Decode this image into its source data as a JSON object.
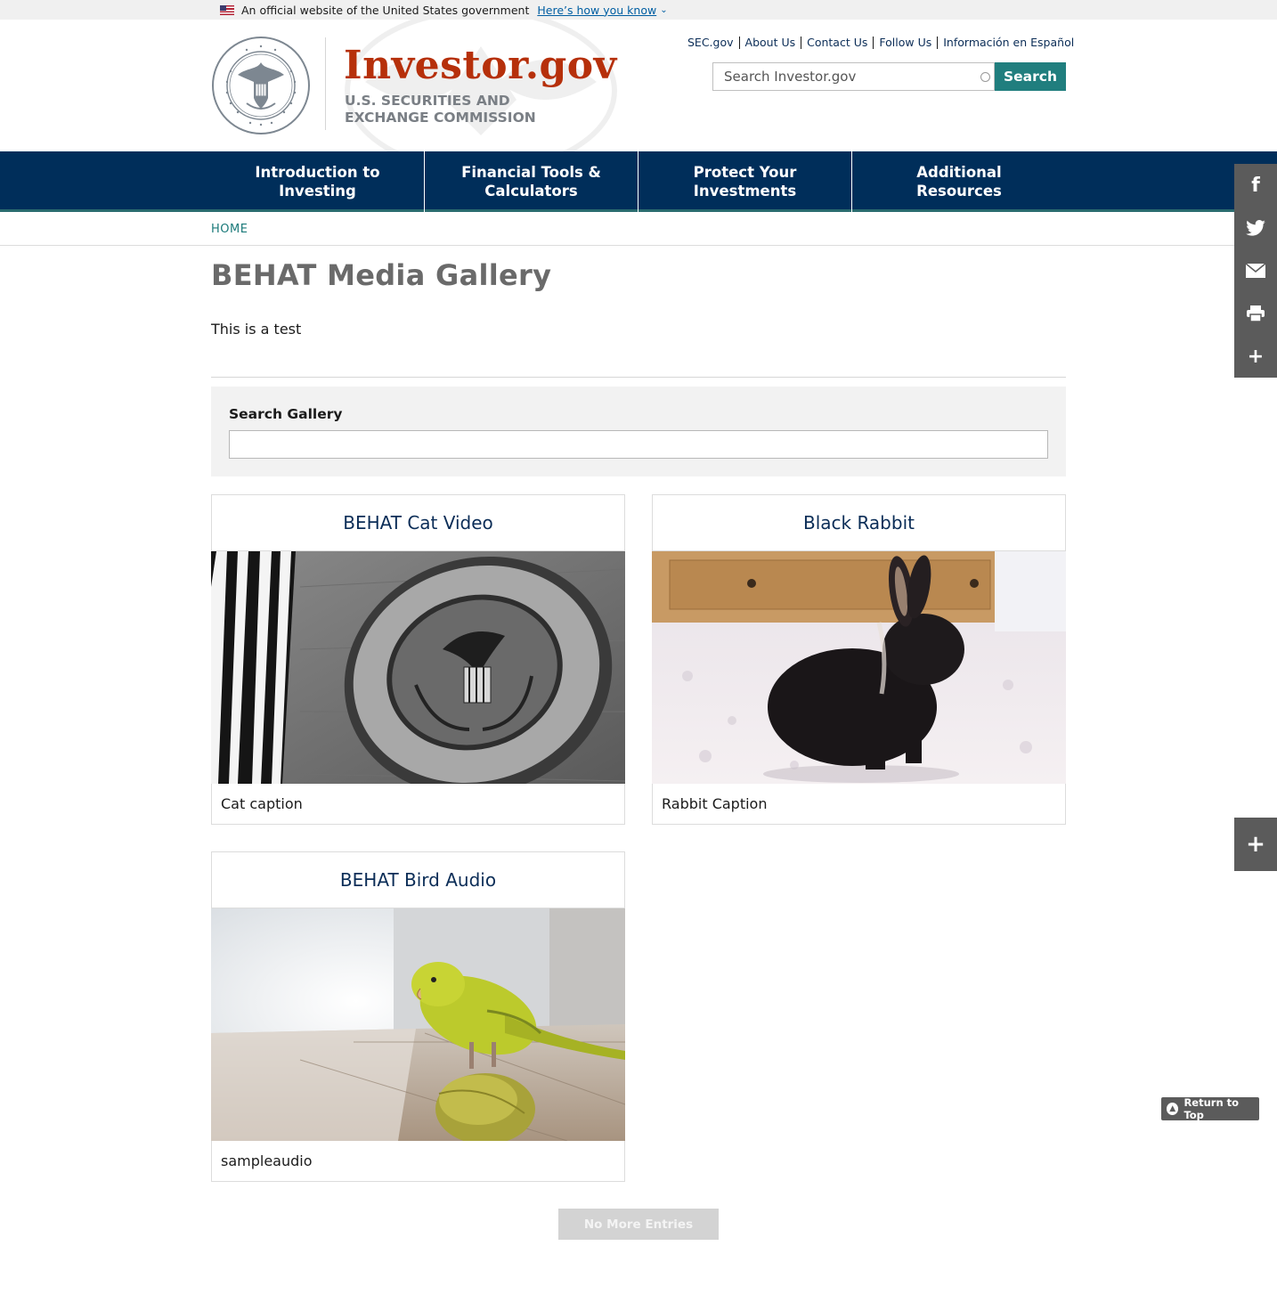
{
  "gov_banner": {
    "text": "An official website of the United States government",
    "link": "Here’s how you know"
  },
  "header": {
    "brand": "Investor.gov",
    "agency_line1": "U.S. SECURITIES AND",
    "agency_line2": "EXCHANGE COMMISSION",
    "utility_links": [
      "SEC.gov",
      "About Us",
      "Contact Us",
      "Follow Us",
      "Información en Español"
    ],
    "search_placeholder": "Search Investor.gov",
    "search_button": "Search"
  },
  "nav": {
    "items": [
      {
        "line1": "Introduction to",
        "line2": "Investing"
      },
      {
        "line1": "Financial Tools &",
        "line2": "Calculators"
      },
      {
        "line1": "Protect Your",
        "line2": "Investments"
      },
      {
        "line1": "Additional",
        "line2": "Resources"
      }
    ]
  },
  "breadcrumb": {
    "home": "HOME"
  },
  "page": {
    "title": "BEHAT Media Gallery",
    "intro": "This is a test"
  },
  "search_gallery": {
    "label": "Search Gallery",
    "value": ""
  },
  "gallery": {
    "items": [
      {
        "title": "BEHAT Cat Video",
        "caption": "Cat caption",
        "image": "sec-seal-building"
      },
      {
        "title": "Black Rabbit",
        "caption": "Rabbit Caption",
        "image": "black-rabbit"
      },
      {
        "title": "BEHAT Bird Audio",
        "caption": "sampleaudio",
        "image": "parakeet-on-ball"
      }
    ],
    "no_more": "No More Entries"
  },
  "share": {
    "icons": [
      "facebook-icon",
      "twitter-icon",
      "email-icon",
      "print-icon",
      "plus-icon"
    ]
  },
  "return_to_top": "Return to Top",
  "colors": {
    "nav_bg": "#002e5a",
    "brand_red": "#b6300b",
    "teal": "#207e7e",
    "share_gray": "#5b5b5b"
  }
}
